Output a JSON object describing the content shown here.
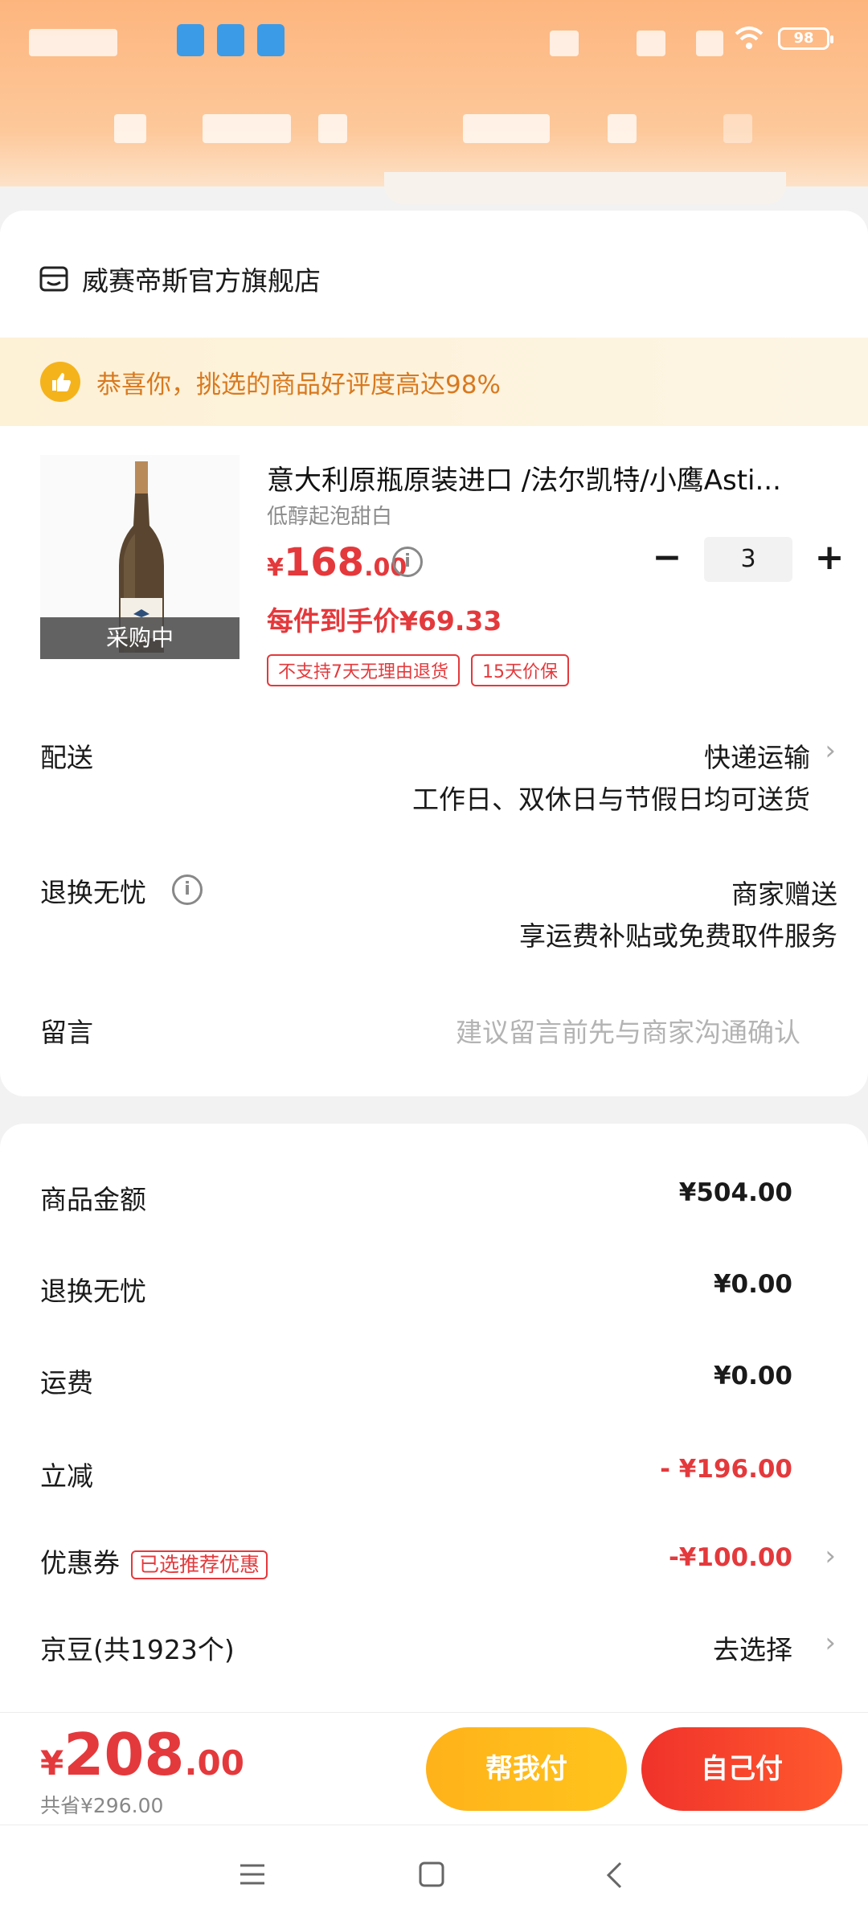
{
  "status_bar": {
    "battery": "98"
  },
  "store": {
    "name": "威赛帝斯官方旗舰店",
    "icon": "store-icon"
  },
  "notice": {
    "text": "恭喜你，挑选的商品好评度高达98%",
    "icon": "thumb-up-icon"
  },
  "product": {
    "title": "意大利原瓶原装进口 /法尔凯特/小鹰Asti...",
    "spec": "低醇起泡甜白",
    "image_label": "采购中",
    "price_currency": "¥",
    "price_int": "168",
    "price_dec": ".00",
    "quantity": "3",
    "unit_price": "每件到手价¥69.33",
    "tags": [
      "不支持7天无理由退货",
      "15天价保"
    ]
  },
  "delivery": {
    "label": "配送",
    "method": "快递运输",
    "note": "工作日、双休日与节假日均可送货"
  },
  "return_service": {
    "label": "退换无忧",
    "value": "商家赠送",
    "note": "享运费补贴或免费取件服务"
  },
  "message": {
    "label": "留言",
    "placeholder": "建议留言前先与商家沟通确认"
  },
  "summary": {
    "goods_amount": {
      "label": "商品金额",
      "value": "¥504.00"
    },
    "return_fee": {
      "label": "退换无忧",
      "value": "¥0.00"
    },
    "shipping": {
      "label": "运费",
      "value": "¥0.00"
    },
    "discount": {
      "label": "立减",
      "value": "- ¥196.00"
    },
    "coupon": {
      "label": "优惠券",
      "badge": "已选推荐优惠",
      "value": "-¥100.00"
    },
    "jd_beans": {
      "label": "京豆(共1923个)",
      "value": "去选择"
    }
  },
  "footer": {
    "total_currency": "¥",
    "total_int": "208",
    "total_dec": ".00",
    "saved": "共省¥296.00",
    "help_pay": "帮我付",
    "self_pay": "自己付"
  },
  "colors": {
    "accent_red": "#e4393c",
    "header_orange": "#fdb57e",
    "help_button": "#ffb21a"
  }
}
